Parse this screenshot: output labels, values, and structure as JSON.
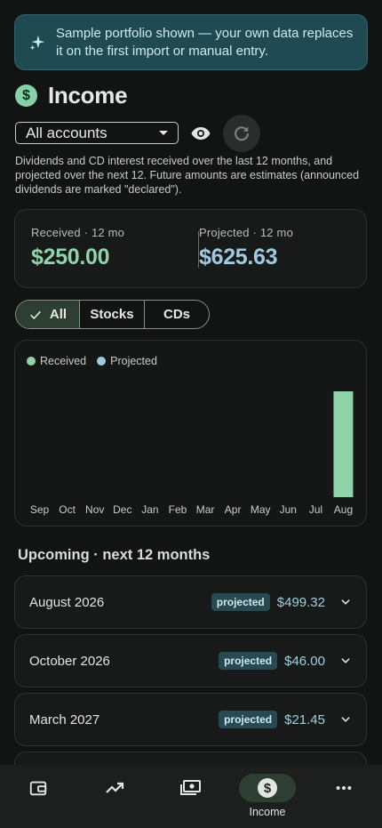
{
  "banner": {
    "icon": "sparkle-icon",
    "text": "Sample portfolio shown — your own data replaces it on the first import or manual entry."
  },
  "header": {
    "title": "Income",
    "icon": "dollar-icon"
  },
  "controls": {
    "account_selected": "All accounts"
  },
  "description": "Dividends and CD interest received over the last 12 months, and projected over the next 12. Future amounts are estimates (announced dividends are marked \"declared\").",
  "summary": {
    "received_label": "Received · 12 mo",
    "received_value": "$250.00",
    "projected_label": "Projected · 12 mo",
    "projected_value": "$625.63"
  },
  "filters": {
    "options": [
      "All",
      "Stocks",
      "CDs"
    ],
    "selected": "All"
  },
  "chart_data": {
    "type": "bar",
    "categories": [
      "Sep",
      "Oct",
      "Nov",
      "Dec",
      "Jan",
      "Feb",
      "Mar",
      "Apr",
      "May",
      "Jun",
      "Jul",
      "Aug"
    ],
    "series": [
      {
        "name": "Received",
        "color": "#8fd4a8",
        "values": [
          0,
          0,
          0,
          0,
          0,
          0,
          0,
          0,
          0,
          0,
          0,
          250
        ]
      },
      {
        "name": "Projected",
        "color": "#9fcbe0",
        "values": [
          0,
          0,
          0,
          0,
          0,
          0,
          0,
          0,
          0,
          0,
          0,
          0
        ]
      }
    ]
  },
  "upcoming": {
    "title": "Upcoming · next 12 months",
    "rows": [
      {
        "month": "August 2026",
        "badge": "projected",
        "amount": "$499.32"
      },
      {
        "month": "October 2026",
        "badge": "projected",
        "amount": "$46.00"
      },
      {
        "month": "March 2027",
        "badge": "projected",
        "amount": "$21.45"
      }
    ]
  },
  "nav": {
    "items": [
      {
        "icon": "wallet-icon",
        "label": ""
      },
      {
        "icon": "trending-up-icon",
        "label": ""
      },
      {
        "icon": "cash-icon",
        "label": ""
      },
      {
        "icon": "dollar-icon",
        "label": "Income"
      },
      {
        "icon": "more-icon",
        "label": ""
      }
    ]
  },
  "colors": {
    "received": "#8fd4a8",
    "projected": "#9fcbe0",
    "accent": "#86d1a6",
    "badge_bg": "#274a52"
  }
}
